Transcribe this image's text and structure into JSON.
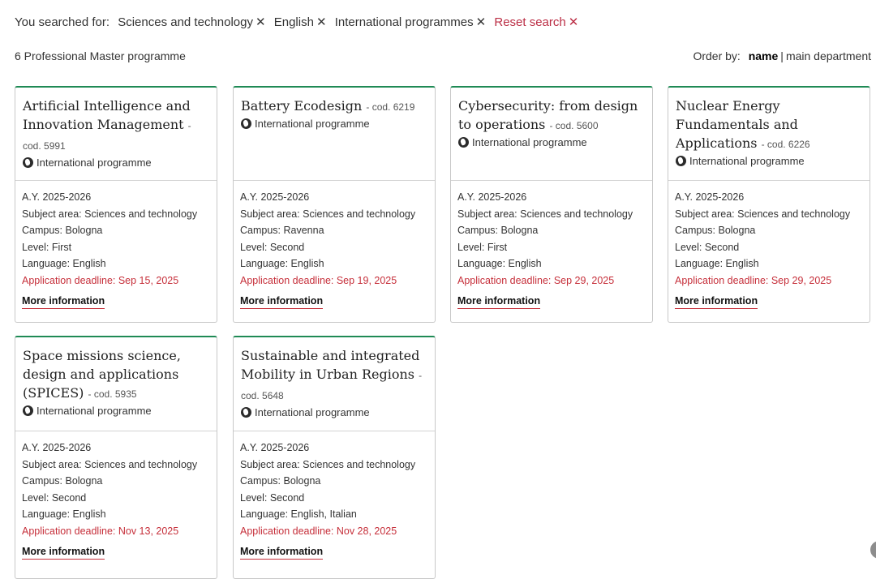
{
  "filters": {
    "prefix": "You searched for:",
    "chips": [
      "Sciences and technology",
      "English",
      "International programmes"
    ],
    "reset": "Reset search",
    "remove_glyph": "✕"
  },
  "results": {
    "count_label": "6 Professional Master programme"
  },
  "order": {
    "label": "Order by:",
    "active": "name",
    "separator": "|",
    "other": "main department"
  },
  "programmes": [
    {
      "title": "Artificial Intelligence and Innovation Management",
      "code": "- cod. 5991",
      "intl": "International programme",
      "year": "A.Y. 2025-2026",
      "subject": "Subject area: Sciences and technology",
      "campus": "Campus: Bologna",
      "level": "Level: First",
      "language": "Language: English",
      "deadline": "Application deadline: Sep 15, 2025",
      "more": "More information"
    },
    {
      "title": "Battery Ecodesign",
      "code": "- cod. 6219",
      "intl": "International programme",
      "year": "A.Y. 2025-2026",
      "subject": "Subject area: Sciences and technology",
      "campus": "Campus: Ravenna",
      "level": "Level: Second",
      "language": "Language: English",
      "deadline": "Application deadline: Sep 19, 2025",
      "more": "More information"
    },
    {
      "title": "Cybersecurity: from design to operations",
      "code": "- cod. 5600",
      "intl": "International programme",
      "year": "A.Y. 2025-2026",
      "subject": "Subject area: Sciences and technology",
      "campus": "Campus: Bologna",
      "level": "Level: First",
      "language": "Language: English",
      "deadline": "Application deadline: Sep 29, 2025",
      "more": "More information"
    },
    {
      "title": "Nuclear Energy Fundamentals and Applications",
      "code": "- cod. 6226",
      "intl": "International programme",
      "year": "A.Y. 2025-2026",
      "subject": "Subject area: Sciences and technology",
      "campus": "Campus: Bologna",
      "level": "Level: Second",
      "language": "Language: English",
      "deadline": "Application deadline: Sep 29, 2025",
      "more": "More information"
    },
    {
      "title": "Space missions science, design and applications (SPICES)",
      "code": "- cod. 5935",
      "intl": "International programme",
      "year": "A.Y. 2025-2026",
      "subject": "Subject area: Sciences and technology",
      "campus": "Campus: Bologna",
      "level": "Level: Second",
      "language": "Language: English",
      "deadline": "Application deadline: Nov 13, 2025",
      "more": "More information"
    },
    {
      "title": "Sustainable and integrated Mobility in Urban Regions",
      "code": "- cod. 5648",
      "intl": "International programme",
      "year": "A.Y. 2025-2026",
      "subject": "Subject area: Sciences and technology",
      "campus": "Campus: Bologna",
      "level": "Level: Second",
      "language": "Language: English, Italian",
      "deadline": "Application deadline: Nov 28, 2025",
      "more": "More information"
    }
  ],
  "colors": {
    "accent_border": "#1f8a55",
    "deadline": "#c62f3a",
    "reset": "#bb2e45"
  }
}
